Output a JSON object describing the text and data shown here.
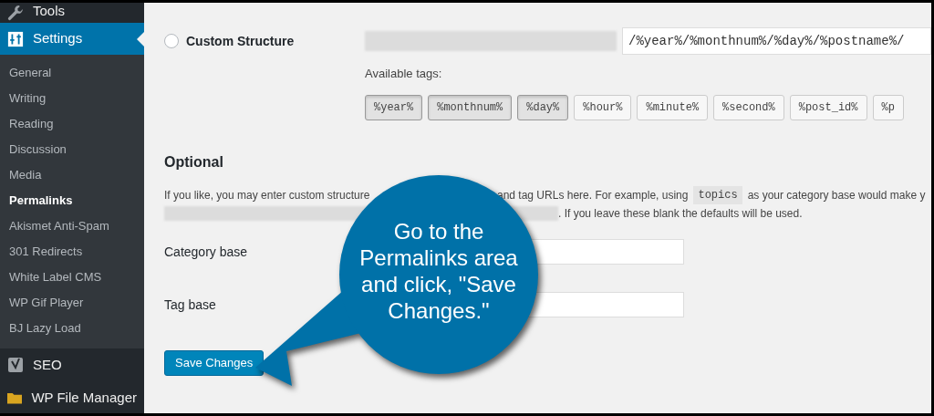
{
  "sidebar": {
    "menu_above": {
      "label": "Tools",
      "selected": false
    },
    "current_menu": {
      "label": "Settings",
      "selected": true,
      "submenu": [
        {
          "label": "General",
          "selected": false
        },
        {
          "label": "Writing",
          "selected": false
        },
        {
          "label": "Reading",
          "selected": false
        },
        {
          "label": "Discussion",
          "selected": false
        },
        {
          "label": "Media",
          "selected": false
        },
        {
          "label": "Permalinks",
          "selected": true
        },
        {
          "label": "Akismet Anti-Spam",
          "selected": false
        },
        {
          "label": "301 Redirects",
          "selected": false
        },
        {
          "label": "White Label CMS",
          "selected": false
        },
        {
          "label": "WP Gif Player",
          "selected": false
        },
        {
          "label": "BJ Lazy Load",
          "selected": false
        }
      ]
    },
    "menu_below": [
      {
        "label": "SEO",
        "selected": false
      },
      {
        "label": "WP File Manager",
        "selected": false
      }
    ]
  },
  "custom_structure": {
    "label": "Custom Structure",
    "selected": false,
    "value": "/%year%/%monthnum%/%day%/%postname%/"
  },
  "available_tags": {
    "label": "Available tags:",
    "tags": [
      {
        "label": "%year%",
        "selected": true
      },
      {
        "label": "%monthnum%",
        "selected": true
      },
      {
        "label": "%day%",
        "selected": true
      },
      {
        "label": "%hour%",
        "selected": false
      },
      {
        "label": "%minute%",
        "selected": false
      },
      {
        "label": "%second%",
        "selected": false
      },
      {
        "label": "%post_id%",
        "selected": false
      },
      {
        "label": "%p",
        "selected": false
      }
    ]
  },
  "optional": {
    "heading": "Optional",
    "text_start": "If you like, you may enter custom structure",
    "text_middle": "and tag URLs here. For example, using",
    "code": "topics",
    "text_end": "as your category base would make y",
    "text_last": ". If you leave these blank the defaults will be used."
  },
  "fields": [
    {
      "label": "Category base"
    },
    {
      "label": "Tag base"
    }
  ],
  "save_button": "Save Changes",
  "callout": {
    "text": "Go to the Permalinks area and click, \"Save Changes.\""
  }
}
